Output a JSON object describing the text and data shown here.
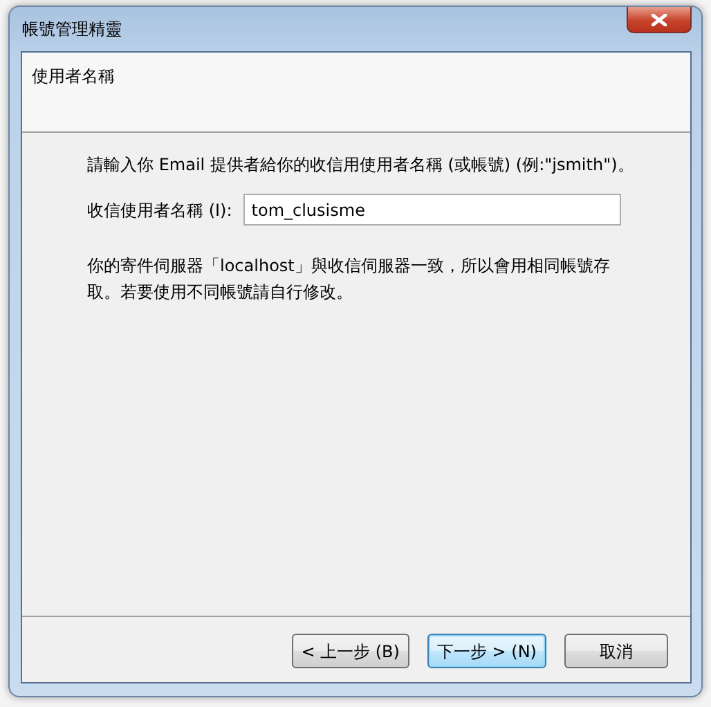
{
  "window": {
    "title": "帳號管理精靈"
  },
  "header": {
    "title": "使用者名稱"
  },
  "intro": "請輸入你 Email 提供者給你的收信用使用者名稱 (或帳號) (例:\"jsmith\")。",
  "username": {
    "label": "收信使用者名稱 (I):",
    "value": "tom_clusisme"
  },
  "note": "你的寄件伺服器「localhost」與收信伺服器一致，所以會用相同帳號存取。若要使用不同帳號請自行修改。",
  "buttons": [
    {
      "label": "< 上一步 (B)",
      "kind": "normal"
    },
    {
      "label": "下一步 > (N)",
      "kind": "default"
    },
    {
      "label": "取消",
      "kind": "normal"
    }
  ]
}
